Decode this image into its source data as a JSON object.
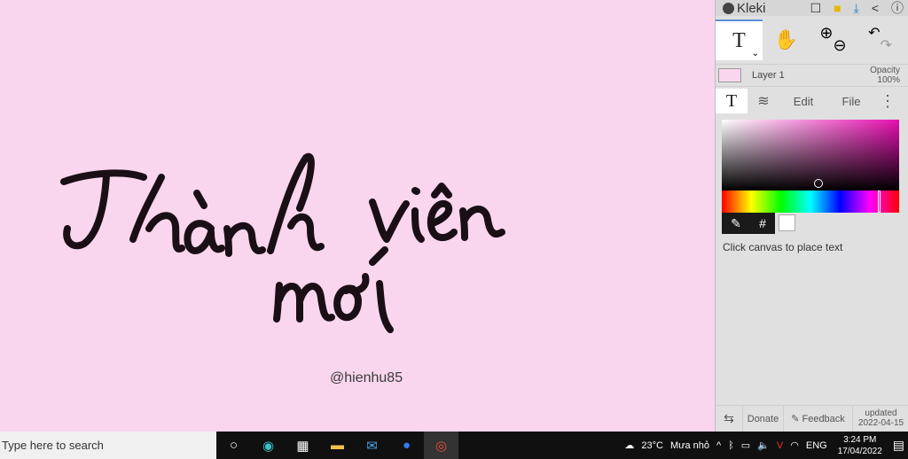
{
  "canvas": {
    "handwriting_line1": "Thành viên",
    "handwriting_line2": "mới",
    "handle": "@hienhu85"
  },
  "app": {
    "name": "Kleki"
  },
  "layer": {
    "name": "Layer 1",
    "opacity_label": "Opacity",
    "opacity_value": "100%"
  },
  "tabs": {
    "edit": "Edit",
    "file": "File"
  },
  "brush": {
    "color_hex": "#ffffff",
    "hue_color": "#e60fb0"
  },
  "hint": "Click canvas to place text",
  "bottom": {
    "donate": "Donate",
    "feedback": "Feedback",
    "updated_label": "updated",
    "updated_date": "2022-04-15"
  },
  "taskbar": {
    "search_placeholder": "Type here to search",
    "weather": "23°C",
    "weather_desc": "Mưa nhỏ",
    "language": "ENG",
    "time": "3:24 PM",
    "date": "17/04/2022"
  }
}
